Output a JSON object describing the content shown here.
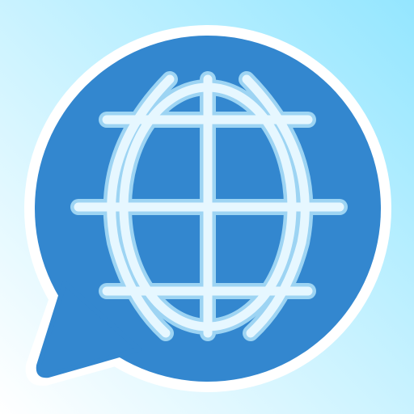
{
  "icon": {
    "name": "translate-chat-icon",
    "glyph": "globe-icon",
    "container": "speech-bubble"
  },
  "colors": {
    "background_light": "#FFFFFF",
    "background_accent": "#94E6FF",
    "bubble_fill": "#3387CF",
    "bubble_outline": "#FFFFFF",
    "globe_stroke": "#E6F7FF",
    "globe_glow": "#A9DDF7"
  }
}
